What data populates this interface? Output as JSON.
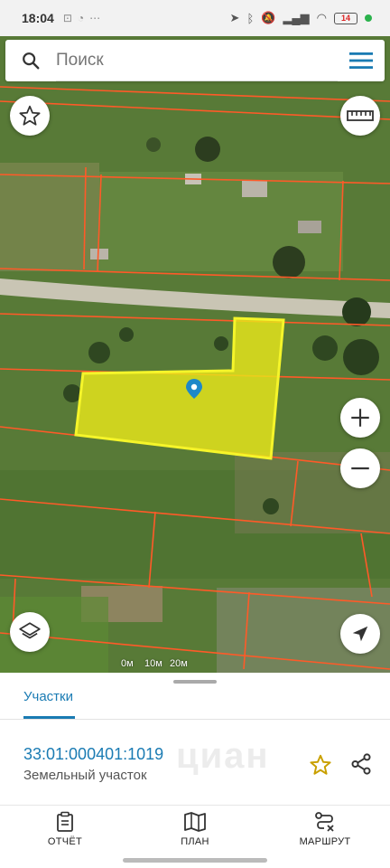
{
  "status_bar": {
    "time": "18:04",
    "battery": "14"
  },
  "search": {
    "placeholder": "Поиск"
  },
  "map": {
    "scale_labels": [
      "0м",
      "10м",
      "20м"
    ],
    "highlight_color": "#e8e61a",
    "boundary_color": "#ff5a28",
    "marker_color": "#1e88c8"
  },
  "sheet": {
    "tab_label": "Участки",
    "parcel_id": "33:01:000401:1019",
    "parcel_type": "Земельный участок",
    "watermark": "циан"
  },
  "nav": {
    "report": "ОТЧЁТ",
    "plan": "ПЛАН",
    "route": "МАРШРУТ"
  },
  "colors": {
    "accent": "#1a7bb3",
    "favorite_star": "#c9a000"
  }
}
